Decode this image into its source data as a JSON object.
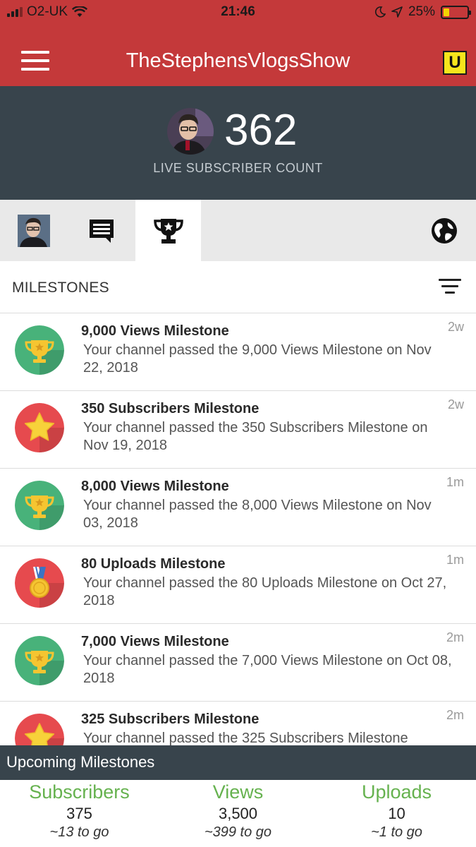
{
  "status_bar": {
    "carrier": "O2-UK",
    "time": "21:46",
    "battery": "25%",
    "battery_level": 0.25,
    "icons": [
      "signal-icon",
      "wifi-icon",
      "moon-icon",
      "location-arrow-icon",
      "battery-icon"
    ]
  },
  "app_bar": {
    "title": "TheStephensVlogsShow",
    "badge": "U"
  },
  "subscriber": {
    "count": "362",
    "label": "LIVE SUBSCRIBER COUNT"
  },
  "tabs": [
    {
      "name": "profile",
      "icon": "avatar-icon"
    },
    {
      "name": "comments",
      "icon": "comment-icon"
    },
    {
      "name": "milestones",
      "icon": "trophy-icon",
      "active": true
    },
    {
      "name": "global",
      "icon": "globe-icon"
    }
  ],
  "milestones_header": {
    "title": "MILESTONES"
  },
  "milestones": [
    {
      "title": "9,000 Views Milestone",
      "desc": "Your channel passed the 9,000 Views Milestone on Nov 22, 2018",
      "time": "2w",
      "icon": "trophy-icon",
      "color": "#48b27a"
    },
    {
      "title": "350 Subscribers Milestone",
      "desc": "Your channel passed the 350 Subscribers Milestone on Nov 19, 2018",
      "time": "2w",
      "icon": "star-icon",
      "color": "#e64a4e"
    },
    {
      "title": "8,000 Views Milestone",
      "desc": "Your channel passed the 8,000 Views Milestone on Nov 03, 2018",
      "time": "1m",
      "icon": "trophy-icon",
      "color": "#48b27a"
    },
    {
      "title": "80 Uploads Milestone",
      "desc": "Your channel passed the 80 Uploads Milestone on Oct 27, 2018",
      "time": "1m",
      "icon": "medal-icon",
      "color": "#e64a4e"
    },
    {
      "title": "7,000 Views Milestone",
      "desc": "Your channel passed the 7,000 Views Milestone on Oct 08, 2018",
      "time": "2m",
      "icon": "trophy-icon",
      "color": "#48b27a"
    },
    {
      "title": "325 Subscribers Milestone",
      "desc": "Your channel passed the 325 Subscribers Milestone",
      "time": "2m",
      "icon": "star-icon",
      "color": "#e64a4e"
    }
  ],
  "upcoming": {
    "title": "Upcoming Milestones",
    "columns": [
      {
        "label": "Subscribers",
        "value": "375",
        "togo": "~13 to go"
      },
      {
        "label": "Views",
        "value": "3,500",
        "togo": "~399 to go"
      },
      {
        "label": "Uploads",
        "value": "10",
        "togo": "~1 to go"
      }
    ]
  }
}
